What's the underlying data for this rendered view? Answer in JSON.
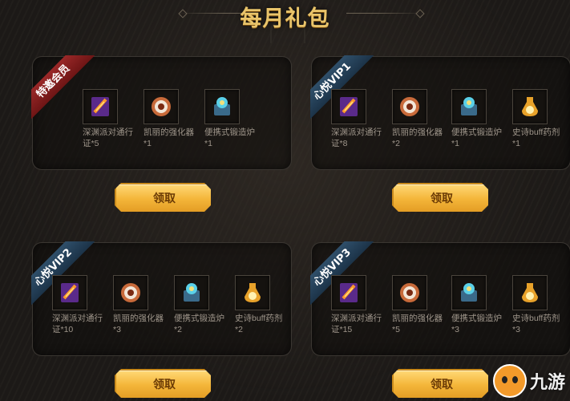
{
  "title": "每月礼包",
  "colors": {
    "gold": "#e9c46a",
    "button": "#f4b63a",
    "ribbon_red": "#8a2020",
    "ribbon_blue": "#2a4660"
  },
  "panels": [
    {
      "tag": "特邀会员",
      "items": [
        {
          "icon": "pass-card-icon",
          "name": "深渊派对通行证*5"
        },
        {
          "icon": "enhancer-icon",
          "name": "凯丽的强化器*1"
        },
        {
          "icon": "forge-icon",
          "name": "便携式锻造炉*1"
        }
      ],
      "button": "领取"
    },
    {
      "tag": "心悦VIP1",
      "items": [
        {
          "icon": "pass-card-icon",
          "name": "深渊派对通行证*8"
        },
        {
          "icon": "enhancer-icon",
          "name": "凯丽的强化器*2"
        },
        {
          "icon": "forge-icon",
          "name": "便携式锻造炉*1"
        },
        {
          "icon": "potion-icon",
          "name": "史诗buff药剂*1"
        }
      ],
      "button": "领取"
    },
    {
      "tag": "心悦VIP2",
      "items": [
        {
          "icon": "pass-card-icon",
          "name": "深渊派对通行证*10"
        },
        {
          "icon": "enhancer-icon",
          "name": "凯丽的强化器*3"
        },
        {
          "icon": "forge-icon",
          "name": "便携式锻造炉*2"
        },
        {
          "icon": "potion-icon",
          "name": "史诗buff药剂*2"
        }
      ],
      "button": "领取"
    },
    {
      "tag": "心悦VIP3",
      "items": [
        {
          "icon": "pass-card-icon",
          "name": "深渊派对通行证*15"
        },
        {
          "icon": "enhancer-icon",
          "name": "凯丽的强化器*5"
        },
        {
          "icon": "forge-icon",
          "name": "便携式锻造炉*3"
        },
        {
          "icon": "potion-icon",
          "name": "史诗buff药剂*3"
        }
      ],
      "button": "领取"
    }
  ],
  "watermark": {
    "text": "九游"
  }
}
